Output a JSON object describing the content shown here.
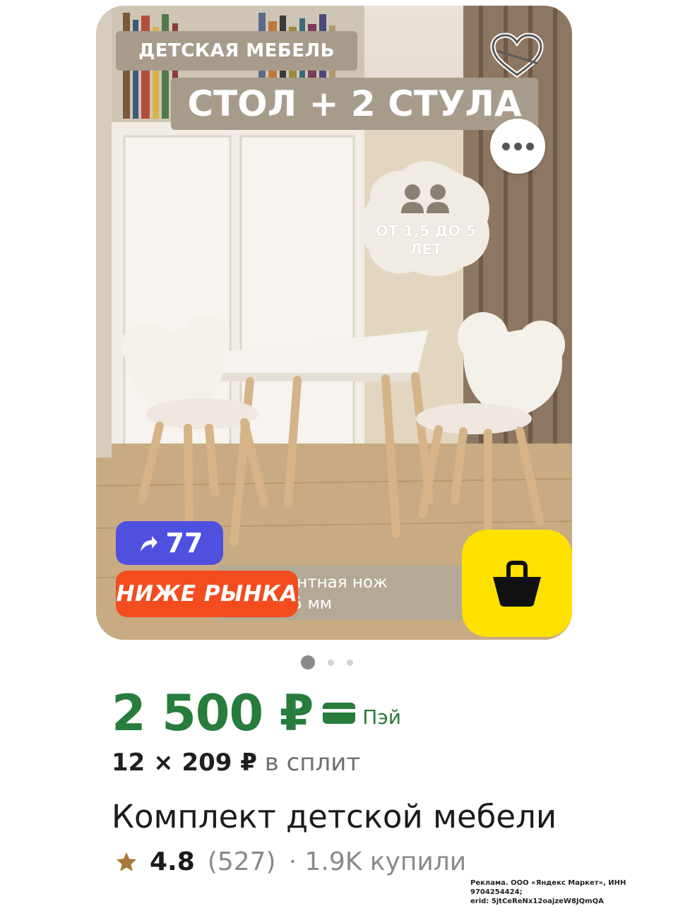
{
  "image": {
    "banner_top": "ДЕТСКАЯ МЕБЕЛЬ",
    "banner_main": "СТОЛ + 2 СТУЛА",
    "age_line1": "ОТ 1,5 ДО 5",
    "age_line2": "ЛЕТ",
    "caption_line1": "E! Элегантная нож",
    "caption_line2": "етром 25 мм"
  },
  "badges": {
    "cashback_value": "77",
    "below_market": "НИЖЕ РЫНКА"
  },
  "carousel": {
    "count": 3,
    "active_index": 0
  },
  "price": {
    "main": "2 500 ₽",
    "pay_label": "Пэй",
    "split_amount": "12 × 209 ₽",
    "split_note": "в сплит"
  },
  "product": {
    "title": "Комплект детской мебели",
    "rating": "4.8",
    "reviews": "(527)",
    "bought": "· 1.9K купили"
  },
  "ad": {
    "line1": "Реклама. ООО «Яндекс Маркет», ИНН 9704254424;",
    "line2": "erid: 5jtCeReNx12oajzeW8JQmQA"
  },
  "colors": {
    "price_green": "#287c3c",
    "cashback_blue": "#4f4fe0",
    "below_market_red": "#f24c1f",
    "basket_yellow": "#ffe100",
    "star": "#a8783a"
  }
}
